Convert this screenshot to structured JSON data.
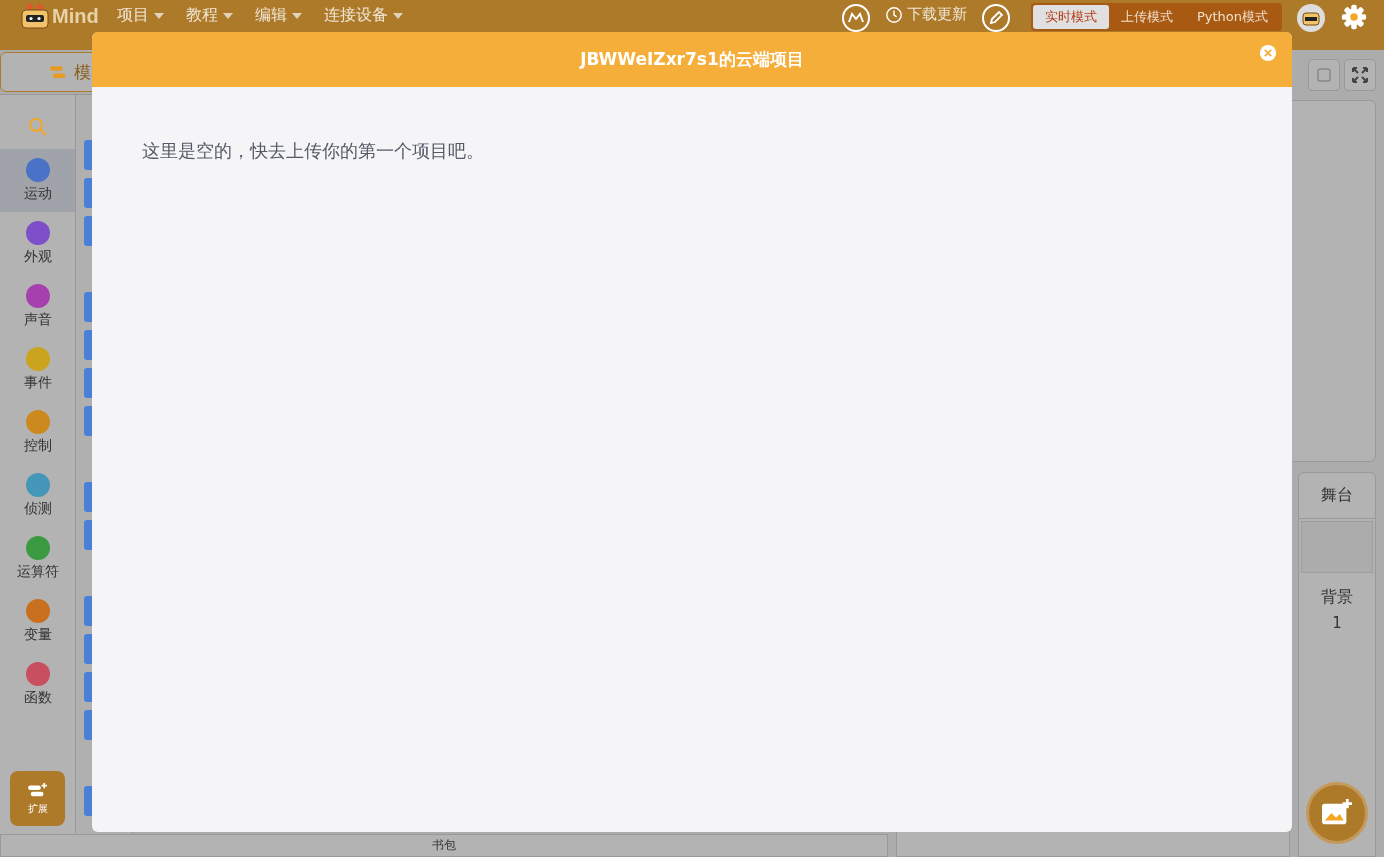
{
  "topbar": {
    "logo_text": "Mind",
    "menus": [
      {
        "label": "项目"
      },
      {
        "label": "教程"
      },
      {
        "label": "编辑"
      },
      {
        "label": "连接设备"
      }
    ],
    "download_label": "下载更新",
    "modes": [
      {
        "label": "实时模式",
        "selected": true
      },
      {
        "label": "上传模式",
        "selected": false
      },
      {
        "label": "Python模式",
        "selected": false
      }
    ]
  },
  "editor_tab": {
    "label": "模"
  },
  "categories": [
    {
      "label": "运动",
      "color": "#4a72c6",
      "selected": true
    },
    {
      "label": "外观",
      "color": "#7d4fc8",
      "selected": false
    },
    {
      "label": "声音",
      "color": "#a540ae",
      "selected": false
    },
    {
      "label": "事件",
      "color": "#c9a41c",
      "selected": false
    },
    {
      "label": "控制",
      "color": "#cc8a1e",
      "selected": false
    },
    {
      "label": "侦测",
      "color": "#4497b9",
      "selected": false
    },
    {
      "label": "运算符",
      "color": "#3b9a40",
      "selected": false
    },
    {
      "label": "变量",
      "color": "#c9701e",
      "selected": false
    },
    {
      "label": "函数",
      "color": "#c74f60",
      "selected": false
    }
  ],
  "extension_label": "扩展",
  "backpack_label": "书包",
  "stage_pane": {
    "title": "舞台",
    "backdrop_label": "背景",
    "backdrop_count": "1"
  },
  "dialog": {
    "title": "JBWWeIZxr7s1的云端项目",
    "message": "这里是空的，快去上传你的第一个项目吧。"
  }
}
